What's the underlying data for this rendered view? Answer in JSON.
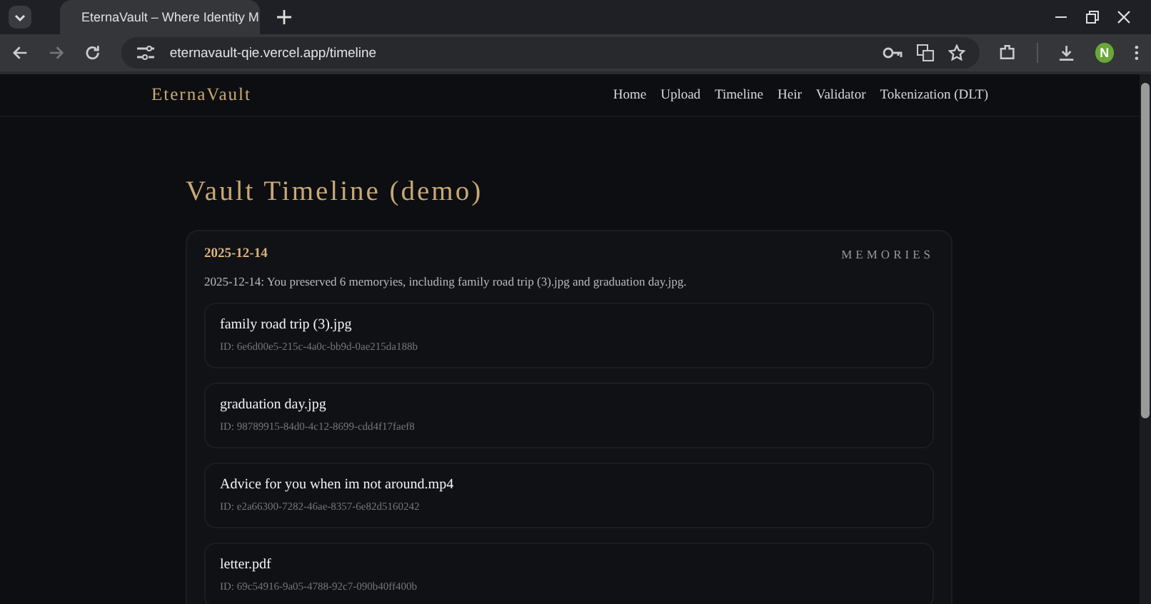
{
  "browser": {
    "tab_title": "EternaVault – Where Identity M",
    "url": "eternavault-qie.vercel.app/timeline",
    "profile_initial": "N"
  },
  "nav": {
    "logo": "EternaVault",
    "links": [
      {
        "label": "Home"
      },
      {
        "label": "Upload"
      },
      {
        "label": "Timeline"
      },
      {
        "label": "Heir"
      },
      {
        "label": "Validator"
      },
      {
        "label": "Tokenization (DLT)"
      }
    ]
  },
  "page_title": "Vault Timeline (demo)",
  "entry": {
    "date": "2025-12-14",
    "category": "MEMORIES",
    "summary": "2025-12-14: You preserved 6 memoryies, including family road trip (3).jpg and graduation day.jpg.",
    "items": [
      {
        "name": "family road trip (3).jpg",
        "id": "ID: 6e6d00e5-215c-4a0c-bb9d-0ae215da188b"
      },
      {
        "name": "graduation day.jpg",
        "id": "ID: 98789915-84d0-4c12-8699-cdd4f17faef8"
      },
      {
        "name": "Advice for you when im not around.mp4",
        "id": "ID: e2a66300-7282-46ae-8357-6e82d5160242"
      },
      {
        "name": "letter.pdf",
        "id": "ID: 69c54916-9a05-4788-92c7-090b40ff400b"
      }
    ]
  }
}
